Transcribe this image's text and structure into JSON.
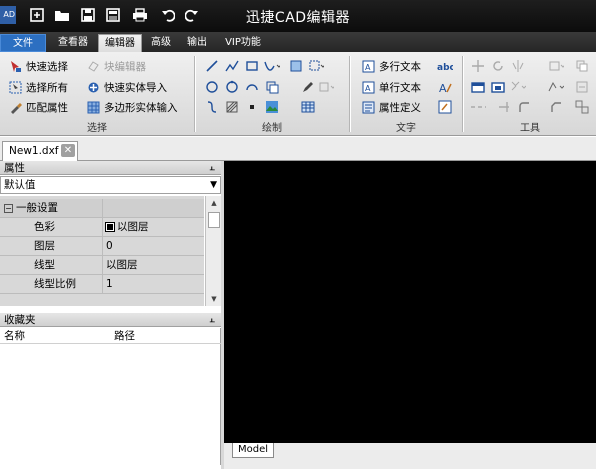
{
  "window": {
    "title": "迅捷CAD编辑器",
    "logo": "AD"
  },
  "quick_access": [
    "new-icon",
    "open-icon",
    "save-icon",
    "save-as-icon",
    "print-icon",
    "undo-icon",
    "redo-icon"
  ],
  "ribbon_tabs": [
    {
      "label": "文件"
    },
    {
      "label": "查看器"
    },
    {
      "label": "编辑器"
    },
    {
      "label": "高级"
    },
    {
      "label": "输出"
    },
    {
      "label": "VIP功能"
    }
  ],
  "ribbon": {
    "select_group": {
      "label": "选择",
      "quick_select": "快速选择",
      "select_all": "选择所有",
      "match_props": "匹配属性",
      "block_editor": "块编辑器",
      "quick_entity_import": "快速实体导入",
      "polygon_entity_input": "多边形实体输入"
    },
    "draw_group": {
      "label": "绘制"
    },
    "text_group": {
      "label": "文字",
      "mtext": "多行文本",
      "stext": "单行文本",
      "attdef": "属性定义"
    },
    "tools_group": {
      "label": "工具"
    }
  },
  "document": {
    "tab_name": "New1.dxf"
  },
  "properties": {
    "header": "属性",
    "combo_value": "默认值",
    "category": "一般设置",
    "rows": [
      {
        "key": "色彩",
        "value": "以图层"
      },
      {
        "key": "图层",
        "value": "0"
      },
      {
        "key": "线型",
        "value": "以图层"
      },
      {
        "key": "线型比例",
        "value": "1"
      }
    ]
  },
  "favorites": {
    "header": "收藏夹",
    "col_name": "名称",
    "col_path": "路径"
  },
  "canvas": {
    "model_tab": "Model"
  },
  "colors": {
    "titlebar": "#141414",
    "file_tab": "#2c6fc1",
    "canvas": "#000000"
  }
}
